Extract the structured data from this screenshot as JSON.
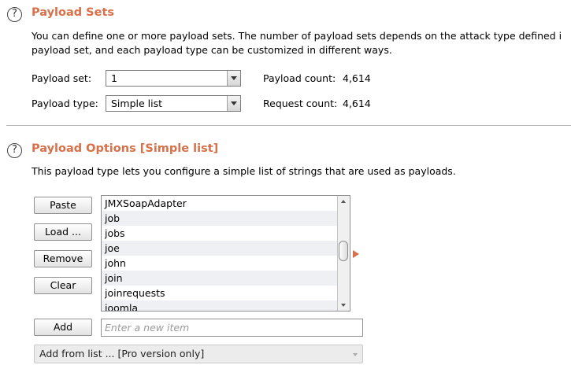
{
  "payload_sets": {
    "title": "Payload Sets",
    "help_glyph": "?",
    "description_line1": "You can define one or more payload sets. The number of payload sets depends on the attack type defined i",
    "description_line2": "payload set, and each payload type can be customized in different ways.",
    "payload_set_label": "Payload set:",
    "payload_set_value": "1",
    "payload_type_label": "Payload type:",
    "payload_type_value": "Simple list",
    "payload_count_label": "Payload count:",
    "payload_count_value": "4,614",
    "request_count_label": "Request count:",
    "request_count_value": "4,614"
  },
  "payload_options": {
    "title": "Payload Options [Simple list]",
    "help_glyph": "?",
    "description": "This payload type lets you configure a simple list of strings that are used as payloads.",
    "buttons": {
      "paste": "Paste",
      "load": "Load ...",
      "remove": "Remove",
      "clear": "Clear",
      "add": "Add"
    },
    "items": [
      "JMXSoapAdapter",
      "job",
      "jobs",
      "joe",
      "john",
      "join",
      "joinrequests",
      "joomla"
    ],
    "new_item_placeholder": "Enter a new item",
    "add_from_list": "Add from list ... [Pro version only]"
  },
  "icons": {
    "help": "help-circle-icon",
    "expand": "triangle-right-icon",
    "accent_color": "#d8704a"
  }
}
